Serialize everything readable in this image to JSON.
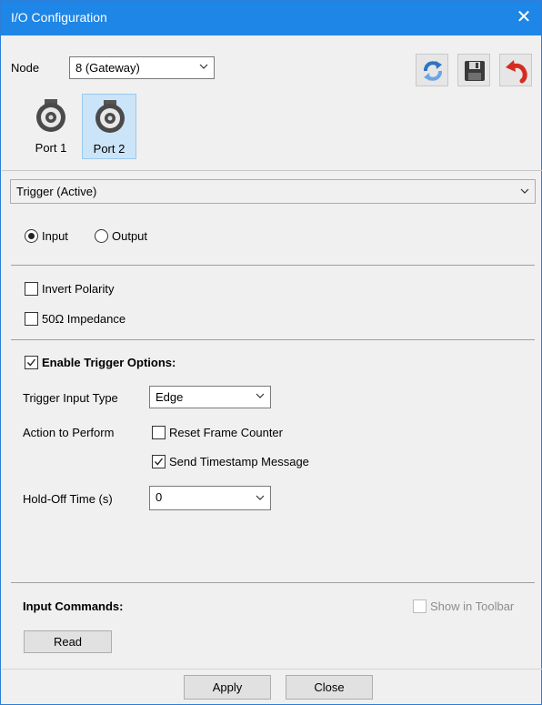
{
  "window": {
    "title": "I/O Configuration",
    "close_glyph": "✕"
  },
  "node": {
    "label": "Node",
    "value": "8 (Gateway)"
  },
  "toolbar": {
    "refresh_icon": "refresh-icon",
    "save_icon": "save-icon",
    "revert_icon": "revert-icon"
  },
  "ports": [
    {
      "label": "Port 1",
      "selected": false
    },
    {
      "label": "Port 2",
      "selected": true
    }
  ],
  "mode_select": {
    "value": "Trigger (Active)"
  },
  "direction": {
    "input_label": "Input",
    "output_label": "Output",
    "selected": "Input"
  },
  "options": {
    "invert_polarity": {
      "label": "Invert Polarity",
      "checked": false
    },
    "impedance": {
      "label": "50Ω Impedance",
      "checked": false
    }
  },
  "trigger": {
    "enable_label": "Enable Trigger Options:",
    "enable_checked": true,
    "input_type_label": "Trigger Input Type",
    "input_type_value": "Edge",
    "action_label": "Action to Perform",
    "reset_frame_label": "Reset Frame Counter",
    "reset_frame_checked": false,
    "send_timestamp_label": "Send Timestamp Message",
    "send_timestamp_checked": true,
    "holdoff_label": "Hold-Off Time (s)",
    "holdoff_value": "0"
  },
  "commands": {
    "title": "Input Commands:",
    "show_toolbar_label": "Show in Toolbar",
    "show_toolbar_checked": false,
    "read_label": "Read"
  },
  "footer": {
    "apply_label": "Apply",
    "close_label": "Close"
  },
  "colors": {
    "titlebar": "#1e86e6",
    "selected_port": "#cce4f7"
  }
}
